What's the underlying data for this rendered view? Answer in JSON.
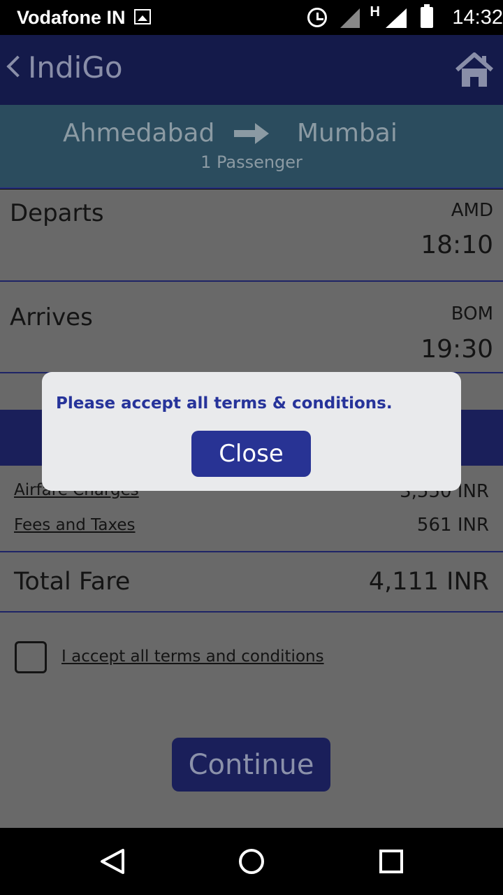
{
  "status_bar": {
    "carrier": "Vodafone IN",
    "network_badge": "H",
    "time": "14:32",
    "icons": [
      "gallery-icon",
      "alarm-icon",
      "signal-icon",
      "battery-icon"
    ]
  },
  "app_bar": {
    "title": "IndiGo",
    "icons": [
      "back-icon",
      "home-icon"
    ]
  },
  "route": {
    "from": "Ahmedabad",
    "to": "Mumbai",
    "passengers": "1 Passenger"
  },
  "departs": {
    "label": "Departs",
    "code": "AMD",
    "time": "18:10"
  },
  "arrives": {
    "label": "Arrives",
    "code": "BOM",
    "time": "19:30"
  },
  "fare": {
    "airfare_label": "Airfare Charges",
    "airfare_value": "3,550 INR",
    "fees_label": "Fees and Taxes",
    "fees_value": "561 INR",
    "total_label": "Total Fare",
    "total_value": "4,111 INR"
  },
  "terms": {
    "label": "I accept all terms and conditions",
    "checked": false
  },
  "continue_label": "Continue",
  "dialog": {
    "message": "Please accept all terms & conditions.",
    "close_label": "Close"
  },
  "colors": {
    "app_bar": "#141a4a",
    "route_banner": "#2b4c5e",
    "dialog_text": "#26339a",
    "dialog_button": "#283394"
  }
}
